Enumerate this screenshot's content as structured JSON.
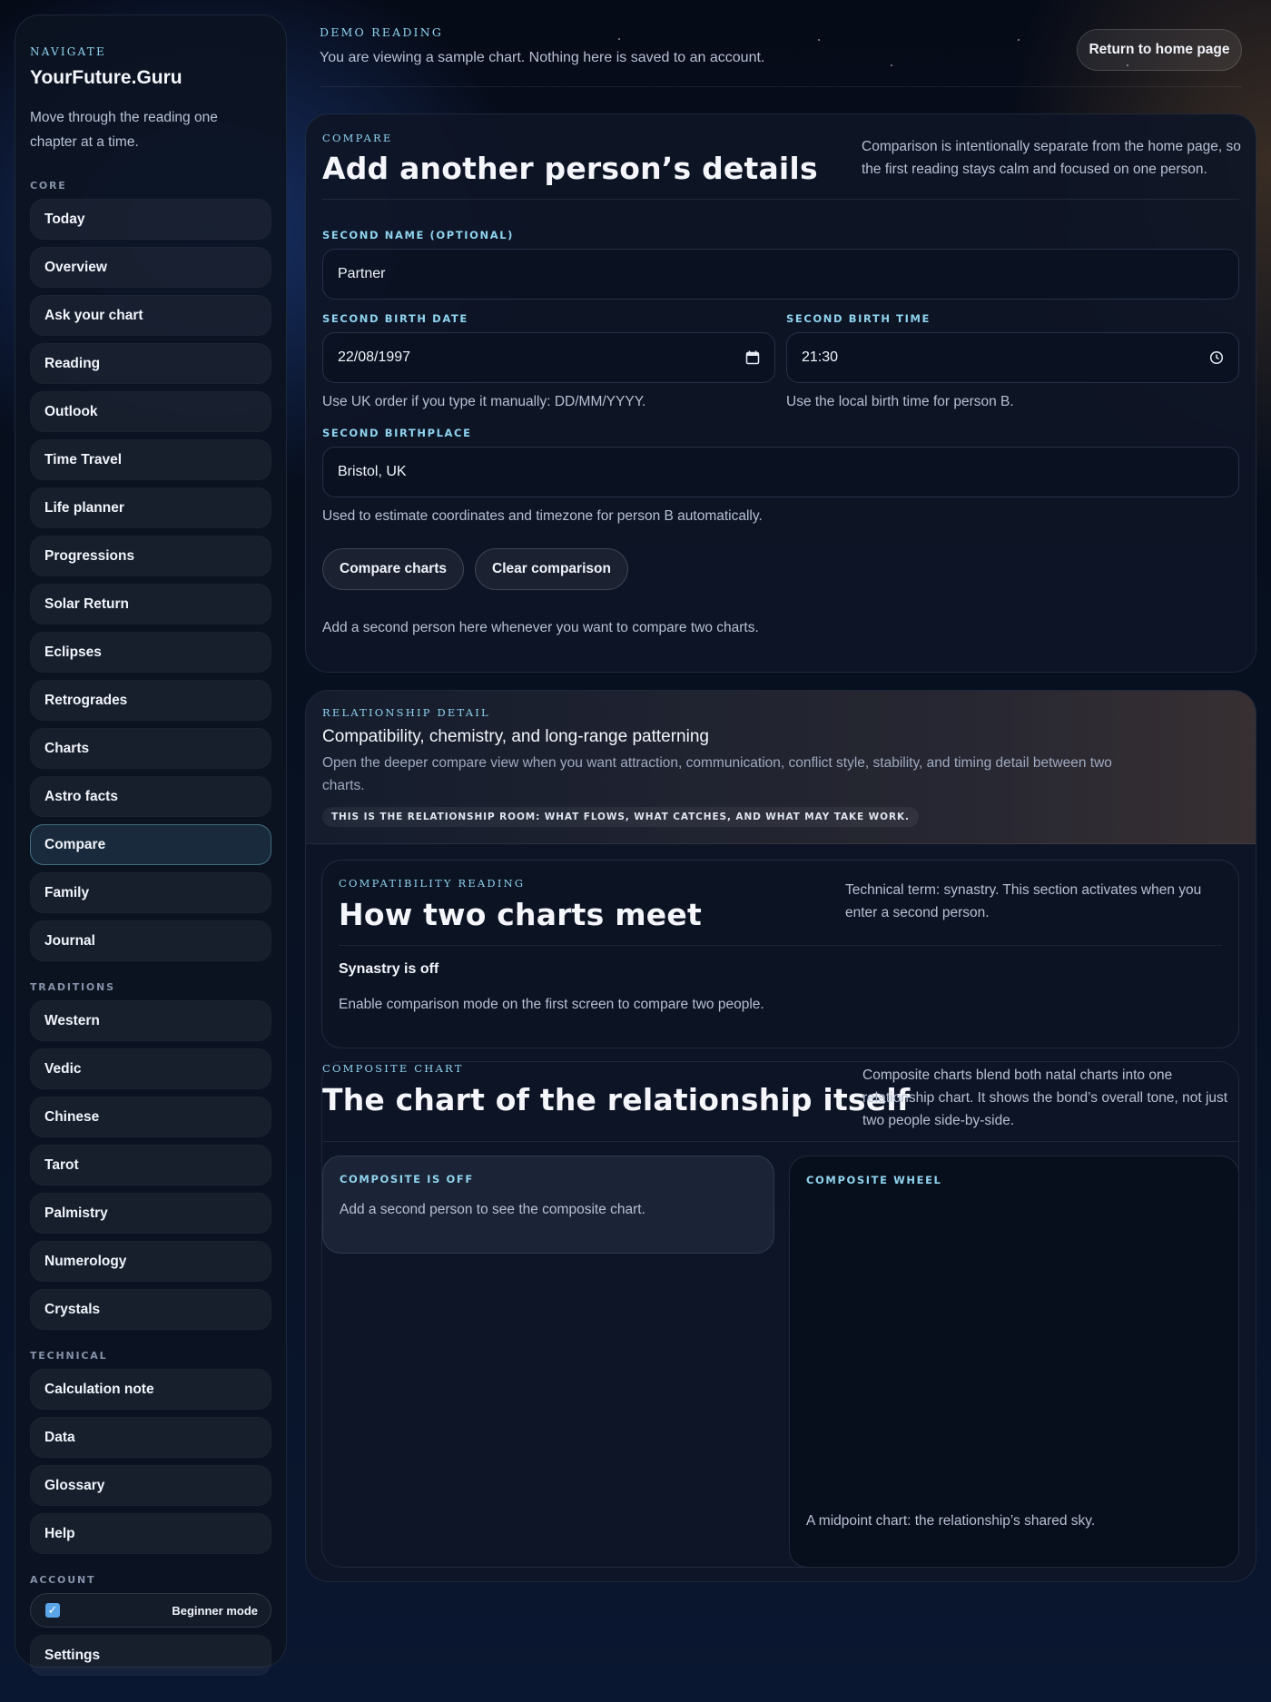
{
  "sidebar": {
    "eyebrow": "NAVIGATE",
    "brand": "YourFuture.Guru",
    "intro": "Move through the reading one chapter at a time.",
    "sections": [
      {
        "title": "CORE",
        "items": [
          "Today",
          "Overview",
          "Ask your chart",
          "Reading",
          "Outlook",
          "Time Travel",
          "Life planner",
          "Progressions",
          "Solar Return",
          "Eclipses",
          "Retrogrades",
          "Charts",
          "Astro facts",
          "Compare",
          "Family",
          "Journal"
        ]
      },
      {
        "title": "TRADITIONS",
        "items": [
          "Western",
          "Vedic",
          "Chinese",
          "Tarot",
          "Palmistry",
          "Numerology",
          "Crystals"
        ]
      },
      {
        "title": "TECHNICAL",
        "items": [
          "Calculation note",
          "Data",
          "Glossary",
          "Help"
        ]
      },
      {
        "title": "ACCOUNT",
        "toggle_label": "Beginner mode",
        "toggle_checked": true,
        "items": [
          "Settings"
        ]
      }
    ],
    "active_item": "Compare"
  },
  "topbar": {
    "eyebrow": "DEMO READING",
    "text": "You are viewing a sample chart. Nothing here is saved to an account.",
    "home_button": "Return to home page"
  },
  "compare": {
    "eyebrow": "COMPARE",
    "title": "Add another person’s details",
    "note": "Comparison is intentionally separate from the home page, so the first reading stays calm and focused on one person.",
    "name_label": "SECOND NAME (OPTIONAL)",
    "name_value": "Partner",
    "date_label": "SECOND BIRTH DATE",
    "date_value": "22/08/1997",
    "date_help": "Use UK order if you type it manually: DD/MM/YYYY.",
    "time_label": "SECOND BIRTH TIME",
    "time_value": "21:30",
    "time_help": "Use the local birth time for person B.",
    "place_label": "SECOND BIRTHPLACE",
    "place_value": "Bristol, UK",
    "place_help": "Used to estimate coordinates and timezone for person B automatically.",
    "compare_button": "Compare charts",
    "clear_button": "Clear comparison",
    "footer": "Add a second person here whenever you want to compare two charts."
  },
  "relationship": {
    "eyebrow": "RELATIONSHIP DETAIL",
    "title": "Compatibility, chemistry, and long-range patterning",
    "description": "Open the deeper compare view when you want attraction, communication, conflict style, stability, and timing detail between two charts.",
    "chip": "THIS IS THE RELATIONSHIP ROOM: WHAT FLOWS, WHAT CATCHES, AND WHAT MAY TAKE WORK.",
    "synastry": {
      "eyebrow": "COMPATIBILITY READING",
      "title": "How two charts meet",
      "note": "Technical term: synastry. This section activates when you enter a second person.",
      "status": "Synastry is off",
      "message": "Enable comparison mode on the first screen to compare two people."
    },
    "composite": {
      "eyebrow": "COMPOSITE CHART",
      "title": "The chart of the relationship itself",
      "note": "Composite charts blend both natal charts into one relationship chart. It shows the bond’s overall tone, not just two people side-by-side.",
      "off_label": "COMPOSITE IS OFF",
      "off_message": "Add a second person to see the composite chart.",
      "wheel_label": "COMPOSITE WHEEL",
      "wheel_caption": "A midpoint chart: the relationship’s shared sky."
    }
  },
  "colors": {
    "accent": "#8fd3ee",
    "checkbox": "#5aa4e8",
    "background": "#07101f"
  }
}
